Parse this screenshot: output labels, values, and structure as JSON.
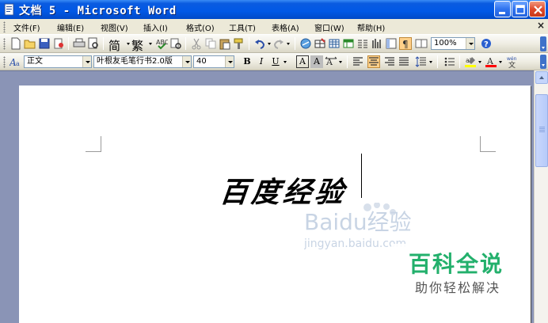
{
  "window": {
    "title": "文档 5 - Microsoft Word"
  },
  "menubar": {
    "items": [
      {
        "label": "文件(F)"
      },
      {
        "label": "编辑(E)"
      },
      {
        "label": "视图(V)"
      },
      {
        "label": "插入(I)"
      },
      {
        "label": "格式(O)"
      },
      {
        "label": "工具(T)"
      },
      {
        "label": "表格(A)"
      },
      {
        "label": "窗口(W)"
      },
      {
        "label": "帮助(H)"
      }
    ],
    "close_doc_glyph": "×"
  },
  "standard_toolbar": {
    "simplified_label": "简",
    "traditional_label": "繁",
    "zoom": "100%",
    "icons": [
      "new-icon",
      "open-icon",
      "save-icon",
      "permission-icon",
      "print-icon",
      "print-preview-icon",
      "simplified-convert-icon",
      "traditional-convert-icon",
      "spelling-icon",
      "research-icon",
      "cut-icon",
      "copy-icon",
      "paste-icon",
      "format-painter-icon",
      "undo-icon",
      "redo-icon",
      "hyperlink-icon",
      "tables-borders-icon",
      "insert-table-icon",
      "insert-excel-icon",
      "columns-icon",
      "drawing-icon",
      "document-map-icon",
      "show-hide-icon",
      "zoom-icon",
      "help-icon"
    ]
  },
  "formatting_toolbar": {
    "style": "正文",
    "font": "叶根友毛笔行书2.0版",
    "size": "40",
    "bold": "B",
    "italic": "I",
    "underline": "U",
    "char_border": "A",
    "char_shading": "A",
    "active_alignment": "center",
    "colors": {
      "highlight": "#ffff00",
      "font_color": "#ff0000"
    }
  },
  "document": {
    "text": "百度经验"
  },
  "watermarks": {
    "baidu_logo": "Baidu经验",
    "baidu_url": "jingyan.baidu.com",
    "baike_title": "百科全说",
    "baike_subtitle": "助你轻松解决"
  },
  "colors": {
    "titlebar": "#0058e6",
    "workspace": "#8a94b6",
    "baike_green": "#23b06c"
  }
}
